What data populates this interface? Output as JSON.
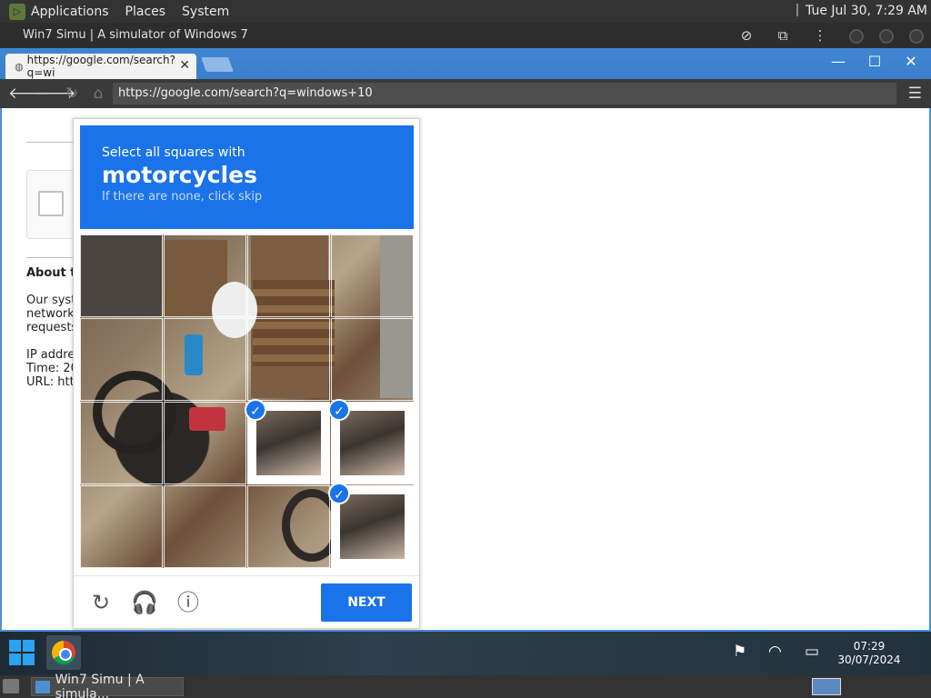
{
  "gnome_panel": {
    "menus": [
      "Applications",
      "Places",
      "System"
    ],
    "clock": "Tue Jul 30,  7:29 AM"
  },
  "host_window": {
    "title": "Win7 Simu | A simulator of Windows 7"
  },
  "browser": {
    "tab_title": "https://google.com/search?q=wi",
    "url": "https://google.com/search?q=windows+10"
  },
  "page": {
    "heading": "About th",
    "lines": [
      "Our syste",
      "network.",
      "requests"
    ],
    "info_lines": [
      "IP addres",
      "Time: 20",
      "URL: http"
    ]
  },
  "captcha": {
    "instruction": "Select all squares with",
    "keyword": "motorcycles",
    "hint": "If there are none, click skip",
    "selected_tiles": [
      10,
      11,
      15
    ],
    "next_label": "NEXT",
    "footer_icons": [
      "reload-icon",
      "audio-icon",
      "info-icon"
    ]
  },
  "taskbar": {
    "time": "07:29",
    "date": "30/07/2024"
  },
  "gnome_bottom": {
    "task_label": "Win7 Simu | A simula..."
  },
  "colors": {
    "captcha_blue": "#1a73e8",
    "chrome_frame": "#4a90d6"
  }
}
